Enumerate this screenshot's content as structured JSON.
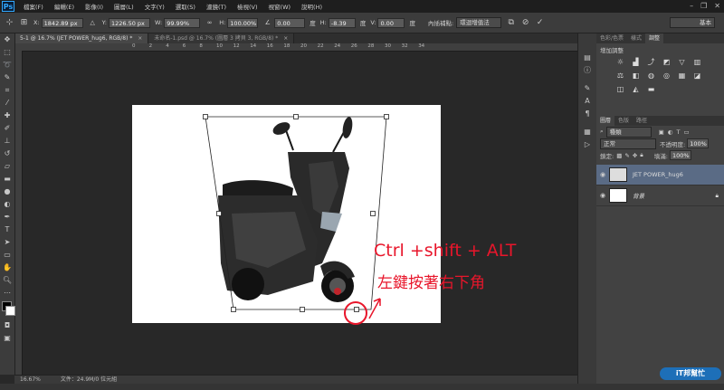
{
  "app": {
    "logo": "Ps"
  },
  "menu": [
    "檔案(F)",
    "編輯(E)",
    "影像(I)",
    "圖層(L)",
    "文字(Y)",
    "選取(S)",
    "濾鏡(T)",
    "檢視(V)",
    "視窗(W)",
    "說明(H)"
  ],
  "window_controls": {
    "minimize": "–",
    "restore": "❐",
    "close": "✕"
  },
  "options": {
    "x_label": "X:",
    "x_value": "1842.89 px",
    "y_label": "Y:",
    "y_value": "1226.50 px",
    "w_label": "W:",
    "w_value": "99.99%",
    "h_label": "H:",
    "h_value": "100.00%",
    "angle_value": "0.00",
    "angle_unit": "度",
    "hskew_label": "H:",
    "hskew_value": "-8.39",
    "hskew_unit": "度",
    "vskew_label": "V:",
    "vskew_value": "0.00",
    "vskew_unit": "度",
    "interp_label": "內插補點:",
    "interp_value": "環迴增值法",
    "workspace_value": "基本"
  },
  "tabs": [
    {
      "label": "5-1 @ 16.7% (JET POWER_hug6, RGB/8) *",
      "active": true
    },
    {
      "label": "未命名-1.psd @ 16.7% (圖層 3 拷貝 3, RGB/8) *",
      "active": false
    }
  ],
  "ruler_top": [
    "0",
    "2",
    "4",
    "6",
    "8",
    "10",
    "12",
    "14",
    "16",
    "18",
    "20",
    "22",
    "24",
    "26",
    "28",
    "30",
    "32",
    "34"
  ],
  "status": {
    "zoom": "16.67%",
    "doc_info": "文件：24.9M/0 位元組"
  },
  "annotation": {
    "line1": "Ctrl +shift + ALT",
    "line2": "左鍵按著右下角"
  },
  "panels": {
    "top_tabs": [
      "色彩/色票",
      "樣式",
      "調整"
    ],
    "adj_title": "增加調整",
    "layer_tabs": [
      "圖層",
      "色版",
      "路徑"
    ],
    "kind_label": "種類",
    "blend_mode": "正常",
    "opacity_label": "不透明度:",
    "opacity_value": "100%",
    "lock_label": "鎖定:",
    "fill_label": "填滿:",
    "fill_value": "100%",
    "layers": [
      {
        "name": "JET POWER_hug6",
        "selected": true
      },
      {
        "name": "背景",
        "selected": false
      }
    ],
    "watermark": "iT邦幫忙"
  },
  "colors": {
    "annotation": "#e8162b",
    "selected_layer": "#5a6b85"
  }
}
